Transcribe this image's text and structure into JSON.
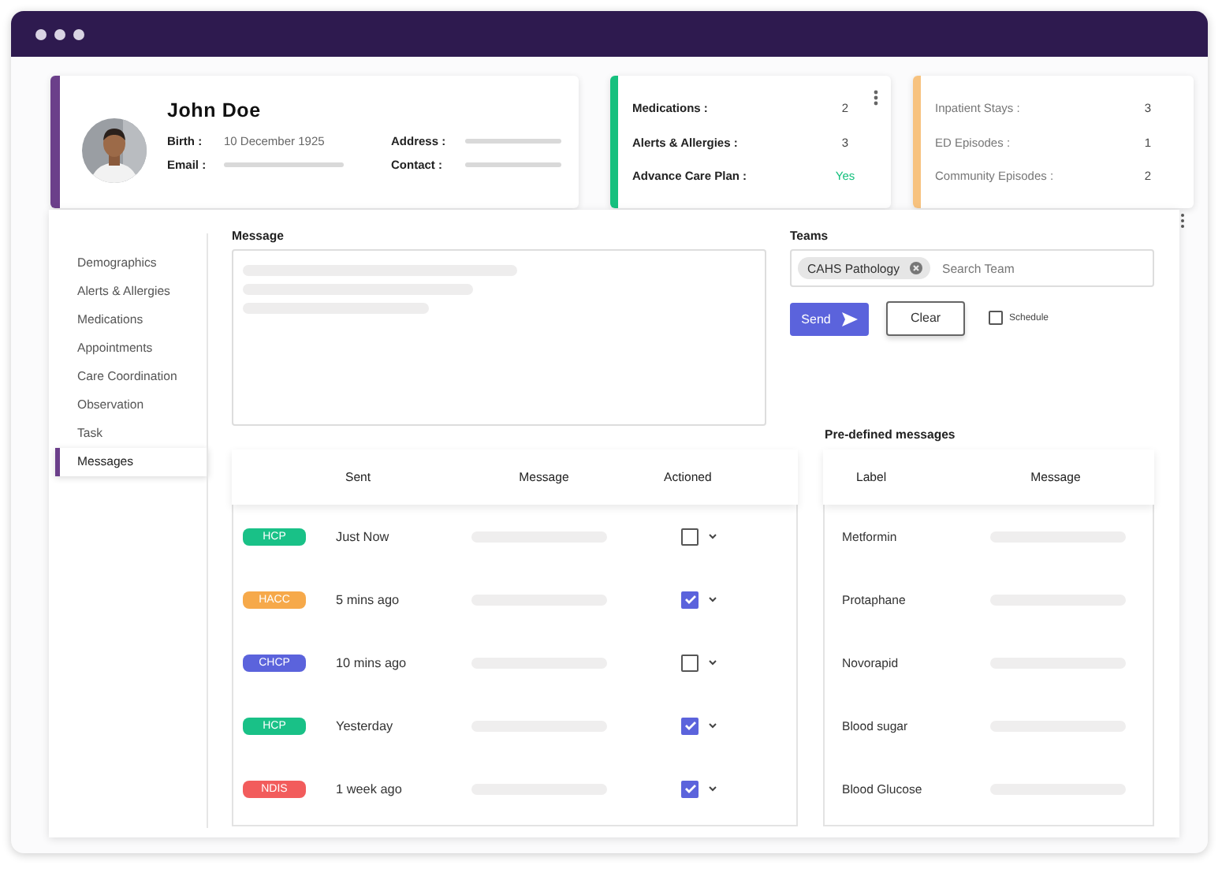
{
  "patient": {
    "name": "John Doe",
    "fields": [
      {
        "label": "Birth :",
        "kind": "text",
        "value": "10 December 1925"
      },
      {
        "label": "Address :",
        "kind": "bar"
      },
      {
        "label": "Email :",
        "kind": "bar"
      },
      {
        "label": "Contact :",
        "kind": "bar"
      }
    ]
  },
  "summary_cards": [
    {
      "color": "#16c07e",
      "menu": true,
      "rows": [
        {
          "label": "Medications :",
          "kind": "count",
          "value": "2"
        },
        {
          "label": "Alerts & Allergies :",
          "kind": "count",
          "value": "3"
        },
        {
          "label": "Advance Care Plan :",
          "kind": "flag",
          "value": "Yes"
        }
      ]
    },
    {
      "color": "#f7c27f",
      "menu": false,
      "rows": [
        {
          "label": "Inpatient Stays :",
          "kind": "count",
          "value": "3"
        },
        {
          "label": "ED Episodes :",
          "kind": "count",
          "value": "1"
        },
        {
          "label": "Community Episodes :",
          "kind": "count",
          "value": "2"
        }
      ]
    }
  ],
  "sidebar": {
    "items": [
      {
        "label": "Demographics",
        "selected": false
      },
      {
        "label": "Alerts & Allergies",
        "selected": false
      },
      {
        "label": "Medications",
        "selected": false
      },
      {
        "label": "Appointments",
        "selected": false
      },
      {
        "label": "Care Coordination",
        "selected": false
      },
      {
        "label": "Observation",
        "selected": false
      },
      {
        "label": "Task",
        "selected": false
      },
      {
        "label": "Messages",
        "selected": true
      }
    ]
  },
  "compose": {
    "message_label": "Message",
    "teams_label": "Teams",
    "team_chips": [
      "CAHS Pathology"
    ],
    "team_placeholder": "Search Team",
    "buttons": [
      {
        "label": "Send",
        "kind": "primary"
      },
      {
        "label": "Clear",
        "kind": "secondary"
      }
    ],
    "schedule": {
      "label": "Schedule",
      "checked": false
    }
  },
  "sent_messages": {
    "columns": [
      "Sent",
      "Message",
      "Actioned"
    ],
    "rows": [
      {
        "tag": "HCP",
        "color": "#19c187",
        "sent": "Just Now",
        "actioned": false
      },
      {
        "tag": "HACC",
        "color": "#f6a94a",
        "sent": "5 mins ago",
        "actioned": true
      },
      {
        "tag": "CHCP",
        "color": "#5b63dc",
        "sent": "10 mins ago",
        "actioned": false
      },
      {
        "tag": "HCP",
        "color": "#19c187",
        "sent": "Yesterday",
        "actioned": true
      },
      {
        "tag": "NDIS",
        "color": "#f25c5c",
        "sent": "1 week ago",
        "actioned": true
      }
    ]
  },
  "predefined": {
    "title": "Pre-defined messages",
    "columns": [
      "Label",
      "Message"
    ],
    "rows": [
      "Metformin",
      "Protaphane",
      "Novorapid",
      "Blood sugar",
      "Blood Glucose"
    ]
  }
}
